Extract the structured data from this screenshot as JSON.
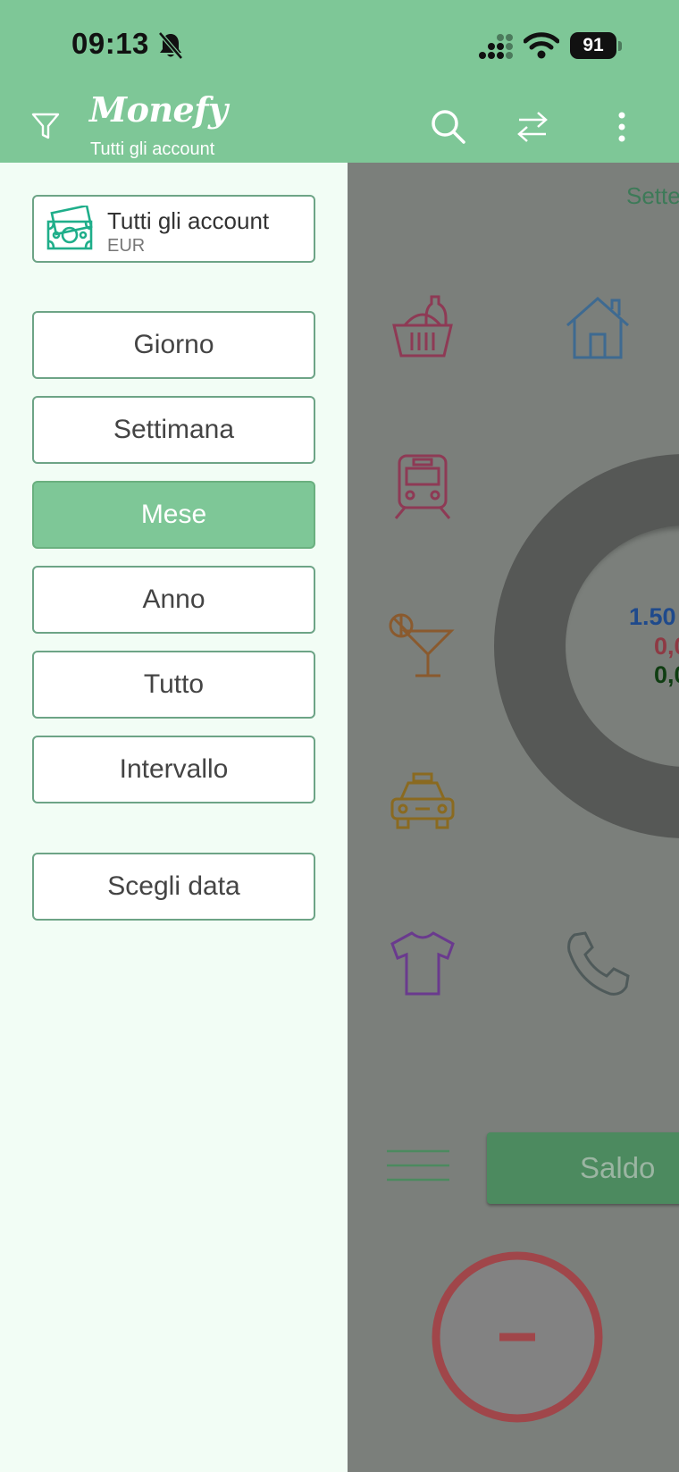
{
  "status_bar": {
    "time": "09:13",
    "battery": "91",
    "icons": [
      "bell-slash-icon",
      "cellular-signal-icon",
      "wifi-icon",
      "battery-icon"
    ]
  },
  "header": {
    "app_name": "Monefy",
    "subtitle": "Tutti gli account",
    "icons": [
      "filter-icon",
      "search-icon",
      "transfer-icon",
      "more-vertical-icon"
    ]
  },
  "drawer": {
    "account": {
      "name": "Tutti gli account",
      "currency": "EUR",
      "icon": "money-bills-icon"
    },
    "periods": [
      {
        "label": "Giorno",
        "active": false
      },
      {
        "label": "Settimana",
        "active": false
      },
      {
        "label": "Mese",
        "active": true
      },
      {
        "label": "Anno",
        "active": false
      },
      {
        "label": "Tutto",
        "active": false
      },
      {
        "label": "Intervallo",
        "active": false
      }
    ],
    "choose_date": "Scegli data"
  },
  "background": {
    "month_partial": "Sette",
    "category_icons": [
      "groceries-icon",
      "house-icon",
      "train-icon",
      "cocktail-icon",
      "taxi-icon",
      "tshirt-icon",
      "phone-icon"
    ],
    "donut_values": {
      "income": "1.50",
      "expense": "0,0",
      "balance": "0,0"
    },
    "saldo_label": "Saldo",
    "minus_button": "minus-icon"
  },
  "colors": {
    "header_green": "#7ec797",
    "drawer_bg": "#f2fdf5",
    "border_green": "#6da486",
    "active_green": "#7ec797",
    "overlay_grey": "#7b7f7b"
  }
}
